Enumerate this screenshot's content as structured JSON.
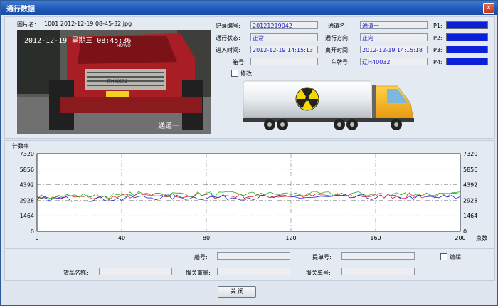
{
  "window": {
    "title": "通行数据",
    "close_label": "×"
  },
  "photo": {
    "filename_label": "图片名:",
    "filename": "1001 2012-12-19 08-45-32.jpg",
    "overlay_timestamp": "2012-12-19 星期三 08:45:36",
    "plate_text": "辽H40032",
    "lane_overlay": "通道一",
    "brand_text": "HOWO"
  },
  "record": {
    "record_no_label": "记录编号:",
    "record_no": "20121219042",
    "status_label": "通行状态:",
    "status": "正常",
    "enter_time_label": "进入时间:",
    "enter_time": "2012-12-19 14:15:13",
    "box_no_label": "箱号:",
    "box_no": "",
    "lane_name_label": "通道名:",
    "lane_name": "通道一",
    "direction_label": "通行方向:",
    "direction": "正向",
    "leave_time_label": "离开时间:",
    "leave_time": "2012-12-19 14:15:18",
    "plate_label": "车牌号:",
    "plate": "辽H40032",
    "p1_label": "P1:",
    "p2_label": "P2:",
    "p3_label": "P3:",
    "p4_label": "P4:",
    "modify_label": "修改"
  },
  "chart_data": {
    "type": "line",
    "title": "计数率",
    "xlabel": "点数",
    "xlim": [
      0,
      200
    ],
    "ylim": [
      0,
      7320
    ],
    "x_ticks": [
      0,
      40,
      80,
      120,
      160,
      200
    ],
    "y_ticks": [
      0,
      1464,
      2928,
      4392,
      5856,
      7320
    ],
    "grid": true,
    "series": [
      {
        "color": "#e02020",
        "mean": 3200,
        "amplitude": 280
      },
      {
        "color": "#20b020",
        "mean": 3350,
        "amplitude": 260
      },
      {
        "color": "#2020e0",
        "mean": 3050,
        "amplitude": 250
      }
    ]
  },
  "form": {
    "ship_no_label": "船号:",
    "ship_no": "",
    "bill_no_label": "提单号:",
    "bill_no": "",
    "edit_label": "编辑",
    "goods_label": "货品名称:",
    "goods": "",
    "declared_weight_label": "报关重量:",
    "declared_weight": "",
    "declaration_no_label": "报关单号:",
    "declaration_no": ""
  },
  "buttons": {
    "close_label": "关 闭"
  }
}
